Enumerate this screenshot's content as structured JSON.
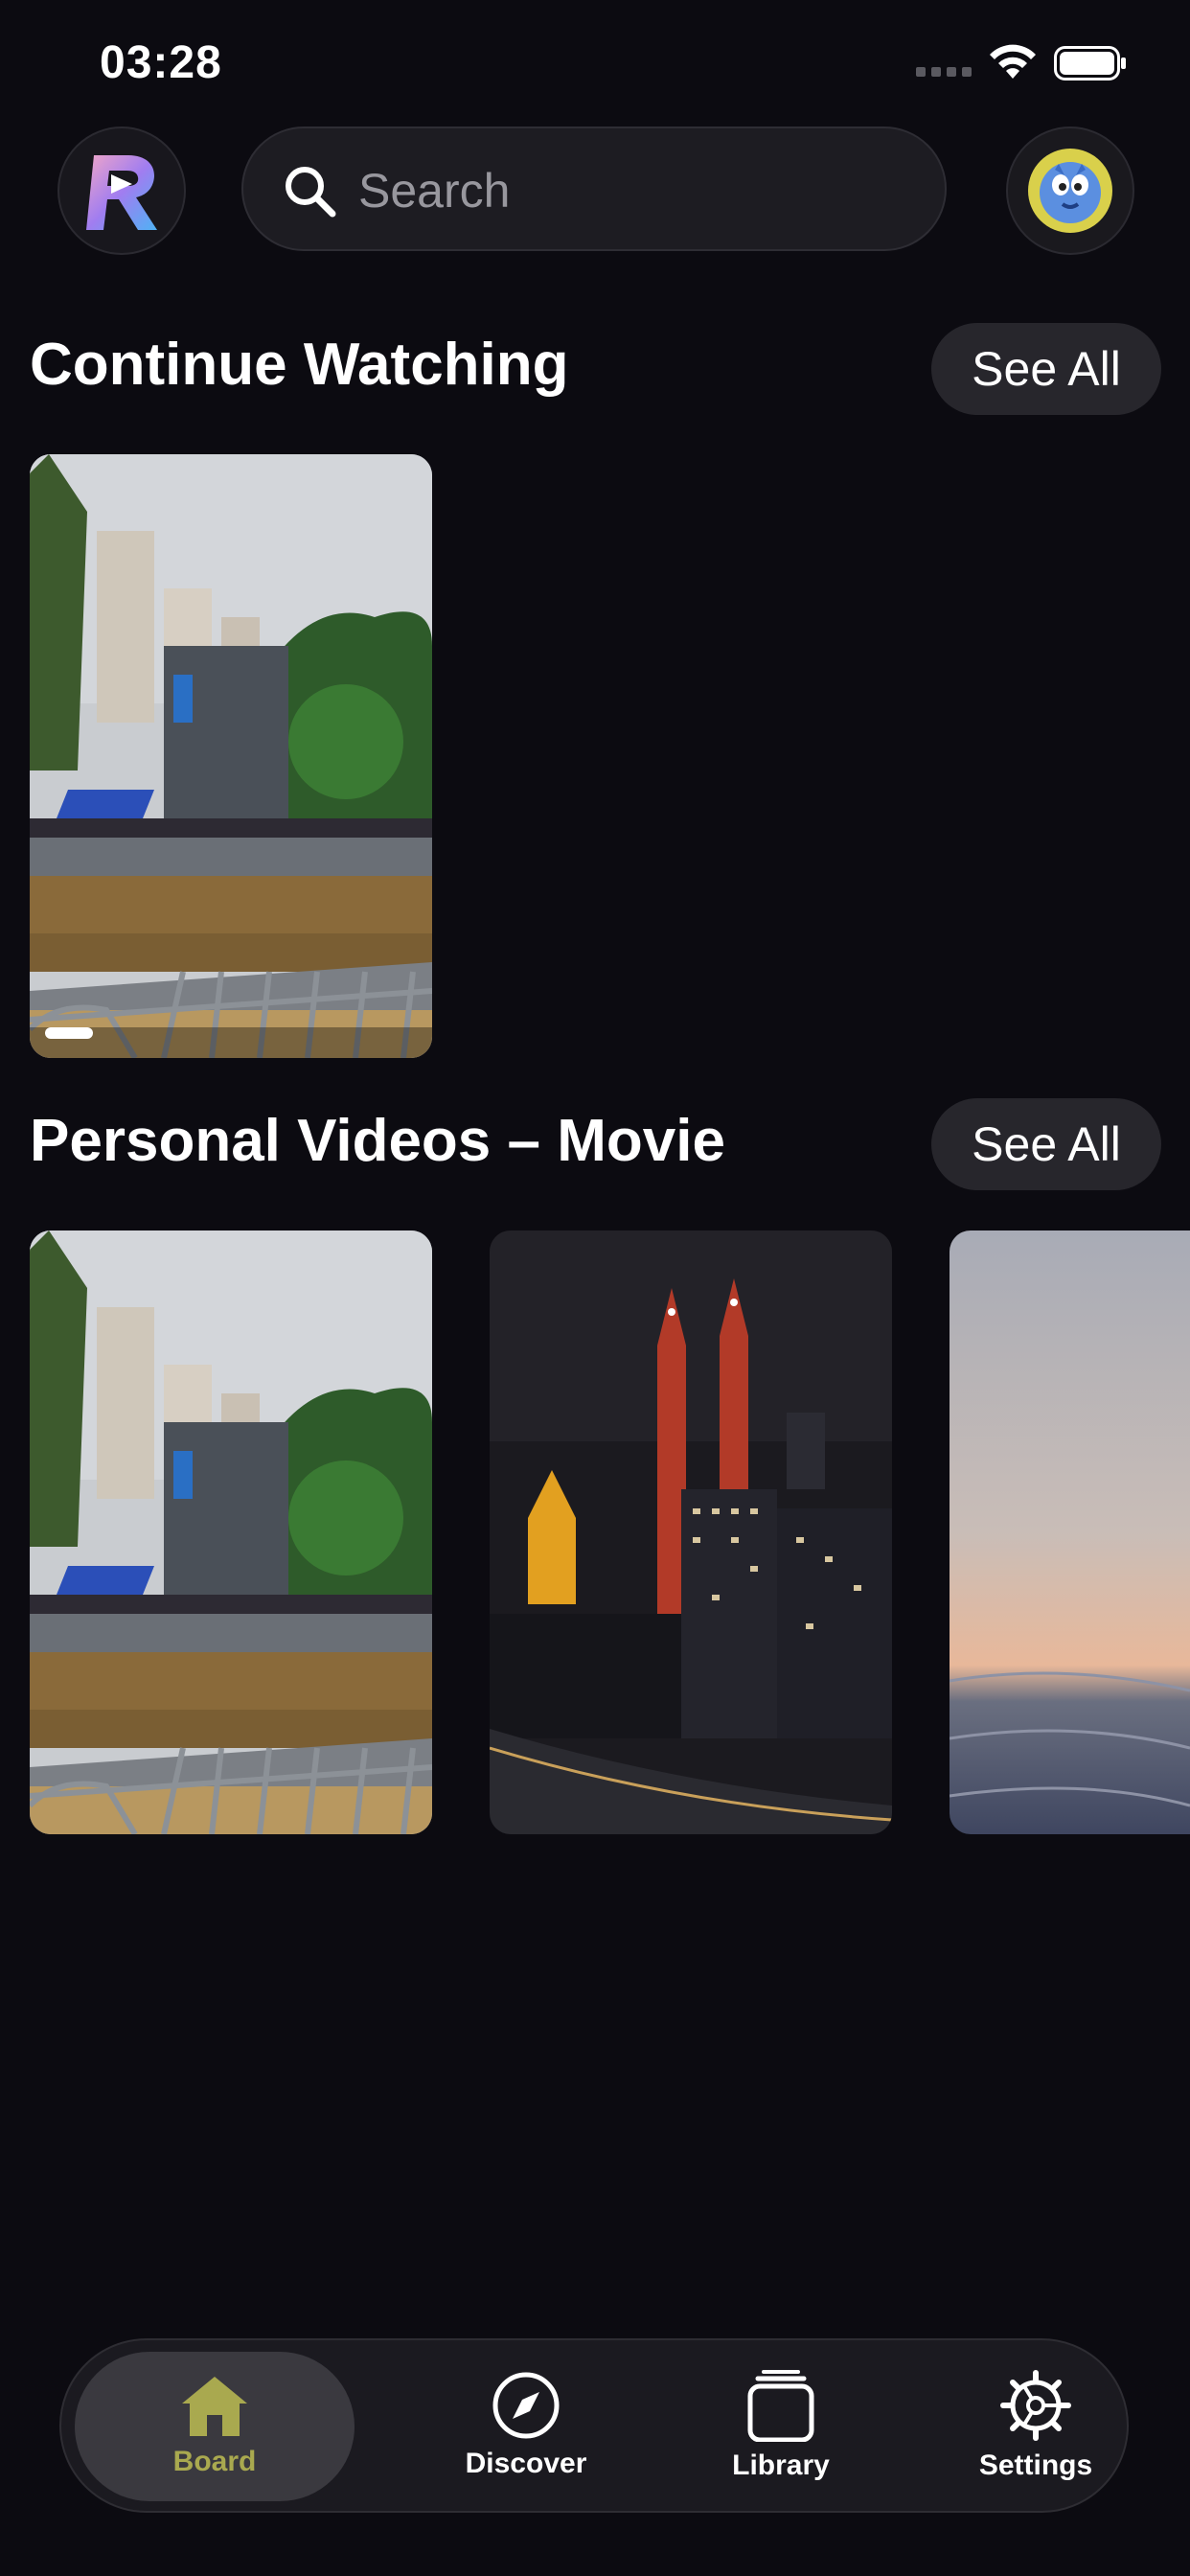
{
  "status": {
    "time": "03:28"
  },
  "search": {
    "placeholder": "Search"
  },
  "sections": {
    "continue": {
      "title": "Continue Watching",
      "see_all": "See All"
    },
    "personal": {
      "title": "Personal Videos – Movie",
      "see_all": "See All"
    }
  },
  "continue_progress": 0.13,
  "nav": [
    {
      "label": "Board",
      "icon": "home-icon"
    },
    {
      "label": "Discover",
      "icon": "compass-icon"
    },
    {
      "label": "Library",
      "icon": "library-icon"
    },
    {
      "label": "Settings",
      "icon": "gear-icon"
    }
  ],
  "colors": {
    "background": "#0c0b11",
    "accent": "#a9a94f",
    "card": "#27262c"
  }
}
